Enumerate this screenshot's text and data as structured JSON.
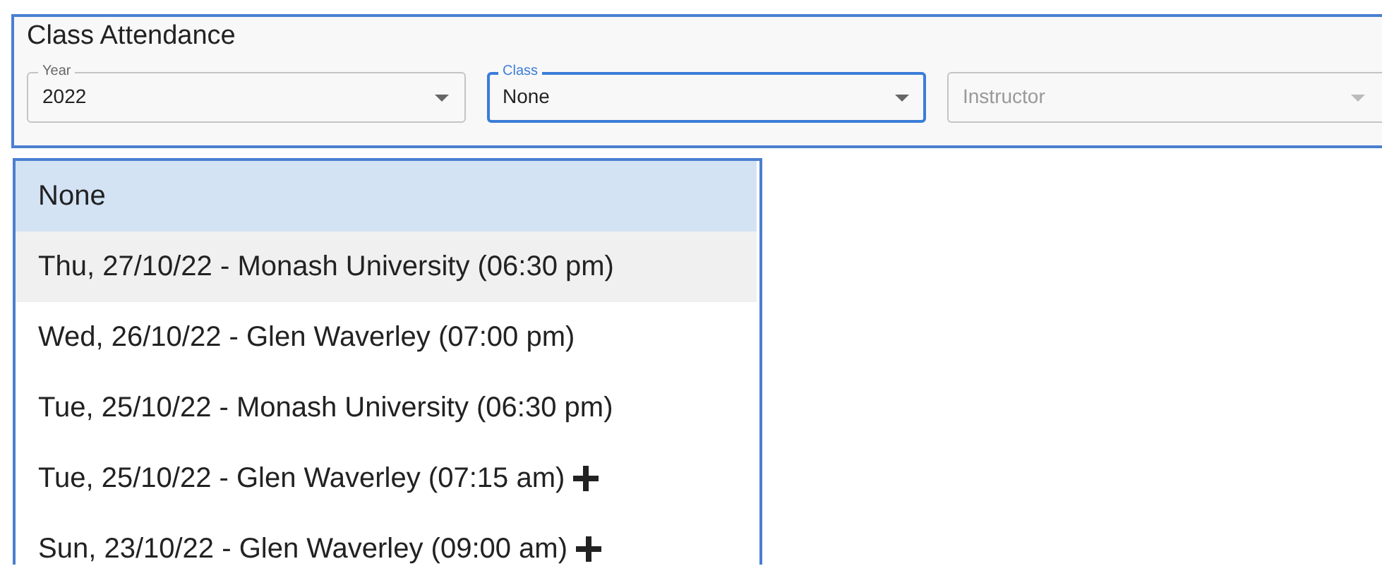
{
  "panel": {
    "title": "Class Attendance"
  },
  "fields": [
    {
      "kind": "select",
      "label": "Year",
      "value": "2022",
      "focused": false,
      "disabled": false
    },
    {
      "kind": "select",
      "label": "Class",
      "value": "None",
      "focused": true,
      "disabled": false
    },
    {
      "kind": "select",
      "placeholder": "Instructor",
      "focused": false,
      "disabled": true
    }
  ],
  "menu": {
    "items": [
      {
        "label": "None",
        "selected": true,
        "hovered": false,
        "plus": false
      },
      {
        "label": "Thu, 27/10/22 - Monash University (06:30 pm)",
        "selected": false,
        "hovered": true,
        "plus": false
      },
      {
        "label": "Wed, 26/10/22 - Glen Waverley (07:00 pm)",
        "selected": false,
        "hovered": false,
        "plus": false
      },
      {
        "label": "Tue, 25/10/22 - Monash University (06:30 pm)",
        "selected": false,
        "hovered": false,
        "plus": false
      },
      {
        "label": "Tue, 25/10/22 - Glen Waverley (07:15 am)",
        "selected": false,
        "hovered": false,
        "plus": true
      },
      {
        "label": "Sun, 23/10/22 - Glen Waverley (09:00 am)",
        "selected": false,
        "hovered": false,
        "plus": true
      }
    ]
  }
}
